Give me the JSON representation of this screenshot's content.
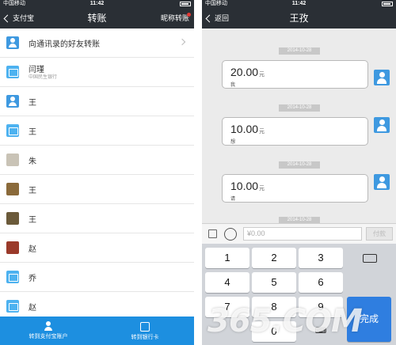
{
  "left": {
    "status": {
      "carrier": "中国移动",
      "time": "11:42"
    },
    "nav": {
      "back_label": "支付宝",
      "title": "转账",
      "right_label": "昵称转账"
    },
    "contacts_entry": {
      "label": "向通讯录的好友转账"
    },
    "rows": [
      {
        "name": "闫瑾",
        "sub": "中国民生银行",
        "avatar": "card"
      },
      {
        "name": "王",
        "sub": "",
        "avatar": "user"
      },
      {
        "name": "王",
        "sub": "",
        "avatar": "card"
      },
      {
        "name": "朱",
        "sub": "",
        "avatar": "photo1"
      },
      {
        "name": "王",
        "sub": "",
        "avatar": "photo2"
      },
      {
        "name": "王",
        "sub": "",
        "avatar": "photo3"
      },
      {
        "name": "赵",
        "sub": "",
        "avatar": "photo4"
      },
      {
        "name": "乔",
        "sub": "",
        "avatar": "card"
      },
      {
        "name": "赵",
        "sub": "",
        "avatar": "card"
      }
    ],
    "bottom": {
      "tab1": "转到支付宝账户",
      "tab2": "转到银行卡"
    }
  },
  "right": {
    "status": {
      "carrier": "中国移动",
      "time": "11:42"
    },
    "nav": {
      "back_label": "返回",
      "title": "王孜"
    },
    "messages": [
      {
        "date": "2014-10-28",
        "amount": "20.00",
        "unit": "元",
        "note": "我"
      },
      {
        "date": "2014-10-28",
        "amount": "10.00",
        "unit": "元",
        "note": "想"
      },
      {
        "date": "2014-10-28",
        "amount": "10.00",
        "unit": "元",
        "note": "请"
      }
    ],
    "last_date": "2014-10-28",
    "input": {
      "placeholder": "¥0.00",
      "pay_label": "付款"
    },
    "keypad": {
      "keys": [
        "1",
        "2",
        "3",
        "4",
        "5",
        "6",
        "7",
        "8",
        "9",
        "0"
      ],
      "done_label": "完成",
      "keyboard_label": "⌨"
    }
  },
  "watermark": "365.COM",
  "colors": {
    "navbar": "#2a2f35",
    "accent": "#1d8fe0",
    "chat_bg": "#ebebeb"
  }
}
